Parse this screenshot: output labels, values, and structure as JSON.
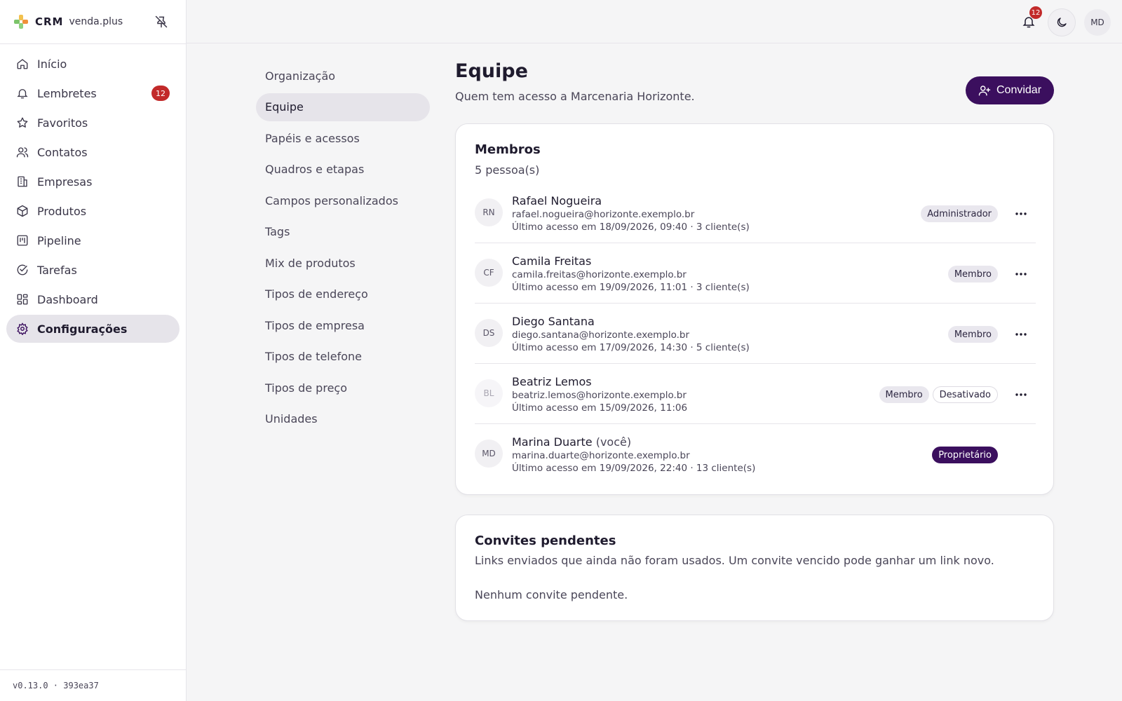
{
  "brand": {
    "crm": "CRM",
    "name": "venda.plus"
  },
  "sidebar": {
    "items": [
      {
        "label": "Início",
        "icon": "home-icon"
      },
      {
        "label": "Lembretes",
        "icon": "bell-icon",
        "badge": "12"
      },
      {
        "label": "Favoritos",
        "icon": "star-icon"
      },
      {
        "label": "Contatos",
        "icon": "users-icon"
      },
      {
        "label": "Empresas",
        "icon": "building-icon"
      },
      {
        "label": "Produtos",
        "icon": "box-icon"
      },
      {
        "label": "Pipeline",
        "icon": "kanban-icon"
      },
      {
        "label": "Tarefas",
        "icon": "check-circle-icon"
      },
      {
        "label": "Dashboard",
        "icon": "dashboard-icon"
      },
      {
        "label": "Configurações",
        "icon": "gear-icon",
        "active": true
      }
    ],
    "version": "v0.13.0 · 393ea37"
  },
  "topbar": {
    "notifications": "12",
    "user_initials": "MD"
  },
  "subnav": {
    "items": [
      "Organização",
      "Equipe",
      "Papéis e acessos",
      "Quadros e etapas",
      "Campos personalizados",
      "Tags",
      "Mix de produtos",
      "Tipos de endereço",
      "Tipos de empresa",
      "Tipos de telefone",
      "Tipos de preço",
      "Unidades"
    ],
    "active": "Equipe"
  },
  "page": {
    "title": "Equipe",
    "subtitle": "Quem tem acesso a Marcenaria Horizonte.",
    "invite_label": "Convidar"
  },
  "members": {
    "title": "Membros",
    "count": "5 pessoa(s)",
    "rows": [
      {
        "initials": "RN",
        "name": "Rafael Nogueira",
        "you": "",
        "email": "rafael.nogueira@horizonte.exemplo.br",
        "access": "Último acesso em 18/09/2026, 09:40 · 3 cliente(s)",
        "role": "Administrador",
        "status": ""
      },
      {
        "initials": "CF",
        "name": "Camila Freitas",
        "you": "",
        "email": "camila.freitas@horizonte.exemplo.br",
        "access": "Último acesso em 19/09/2026, 11:01 · 3 cliente(s)",
        "role": "Membro",
        "status": ""
      },
      {
        "initials": "DS",
        "name": "Diego Santana",
        "you": "",
        "email": "diego.santana@horizonte.exemplo.br",
        "access": "Último acesso em 17/09/2026, 14:30 · 5 cliente(s)",
        "role": "Membro",
        "status": ""
      },
      {
        "initials": "BL",
        "name": "Beatriz Lemos",
        "you": "",
        "email": "beatriz.lemos@horizonte.exemplo.br",
        "access": "Último acesso em 15/09/2026, 11:06",
        "role": "Membro",
        "status": "Desativado"
      },
      {
        "initials": "MD",
        "name": "Marina Duarte",
        "you": "(você)",
        "email": "marina.duarte@horizonte.exemplo.br",
        "access": "Último acesso em 19/09/2026, 22:40 · 13 cliente(s)",
        "role": "Proprietário",
        "status": ""
      }
    ]
  },
  "invites": {
    "title": "Convites pendentes",
    "description": "Links enviados que ainda não foram usados. Um convite vencido pode ganhar um link novo.",
    "empty": "Nenhum convite pendente."
  },
  "colors": {
    "accent": "#3b0f5e",
    "badge_red": "#c22a2a",
    "active_bg": "#e6e4ea"
  }
}
